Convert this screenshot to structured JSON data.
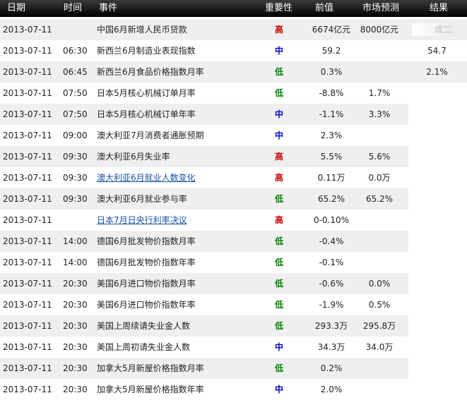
{
  "header": {
    "date": "日期",
    "time": "时间",
    "event": "事件",
    "importance": "重要性",
    "previous": "前值",
    "forecast": "市场预测",
    "result": "结果"
  },
  "colors": {
    "header_background": "#000000",
    "importance_high": "#cc0000",
    "importance_medium": "#0000cc",
    "importance_low": "#008000",
    "link": "#1a52a8",
    "row_stripe": "#efefef"
  },
  "rows": [
    {
      "date": "2013-07-11",
      "time": "",
      "event": "中国6月新增人民币贷款",
      "importance": "高",
      "previous": "6674亿元",
      "forecast": "8000亿元",
      "result": "",
      "link": false
    },
    {
      "date": "2013-07-11",
      "time": "06:30",
      "event": "新西兰6月制造业表现指数",
      "importance": "中",
      "previous": "59.2",
      "forecast": "",
      "result": "54.7",
      "link": false
    },
    {
      "date": "2013-07-11",
      "time": "06:45",
      "event": "新西兰6月食品价格指数月率",
      "importance": "低",
      "previous": "0.3%",
      "forecast": "",
      "result": "2.1%",
      "link": false
    },
    {
      "date": "2013-07-11",
      "time": "07:50",
      "event": "日本5月核心机械订单月率",
      "importance": "低",
      "previous": "-8.8%",
      "forecast": "1.7%",
      "result": "",
      "link": false
    },
    {
      "date": "2013-07-11",
      "time": "07:50",
      "event": "日本5月核心机械订单年率",
      "importance": "中",
      "previous": "-1.1%",
      "forecast": "3.3%",
      "result": "",
      "link": false
    },
    {
      "date": "2013-07-11",
      "time": "09:00",
      "event": "澳大利亚7月消费者通胀预期",
      "importance": "中",
      "previous": "2.3%",
      "forecast": "",
      "result": "",
      "link": false
    },
    {
      "date": "2013-07-11",
      "time": "09:30",
      "event": "澳大利亚6月失业率",
      "importance": "高",
      "previous": "5.5%",
      "forecast": "5.6%",
      "result": "",
      "link": false
    },
    {
      "date": "2013-07-11",
      "time": "09:30",
      "event": "澳大利亚6月就业人数变化",
      "importance": "高",
      "previous": "0.11万",
      "forecast": "0.0万",
      "result": "",
      "link": true
    },
    {
      "date": "2013-07-11",
      "time": "09:30",
      "event": "澳大利亚6月就业参与率",
      "importance": "低",
      "previous": "65.2%",
      "forecast": "65.2%",
      "result": "",
      "link": false
    },
    {
      "date": "2013-07-11",
      "time": "",
      "event": "日本7月日央行利率决议",
      "importance": "高",
      "previous": "0-0.10%",
      "forecast": "",
      "result": "",
      "link": true
    },
    {
      "date": "2013-07-11",
      "time": "14:00",
      "event": "德国6月批发物价指数月率",
      "importance": "低",
      "previous": "-0.4%",
      "forecast": "",
      "result": "",
      "link": false
    },
    {
      "date": "2013-07-11",
      "time": "14:00",
      "event": "德国6月批发物价指数年率",
      "importance": "低",
      "previous": "-0.1%",
      "forecast": "",
      "result": "",
      "link": false
    },
    {
      "date": "2013-07-11",
      "time": "20:30",
      "event": "美国6月进口物价指数月率",
      "importance": "低",
      "previous": "-0.6%",
      "forecast": "0.0%",
      "result": "",
      "link": false
    },
    {
      "date": "2013-07-11",
      "time": "20:30",
      "event": "美国6月进口物价指数年率",
      "importance": "低",
      "previous": "-1.9%",
      "forecast": "0.5%",
      "result": "",
      "link": false
    },
    {
      "date": "2013-07-11",
      "time": "20:30",
      "event": "美国上周续请失业金人数",
      "importance": "低",
      "previous": "293.3万",
      "forecast": "295.8万",
      "result": "",
      "link": false
    },
    {
      "date": "2013-07-11",
      "time": "20:30",
      "event": "美国上周初请失业金人数",
      "importance": "中",
      "previous": "34.3万",
      "forecast": "34.0万",
      "result": "",
      "link": false
    },
    {
      "date": "2013-07-11",
      "time": "20:30",
      "event": "加拿大5月新屋价格指数月率",
      "importance": "低",
      "previous": "0.2%",
      "forecast": "",
      "result": "",
      "link": false
    },
    {
      "date": "2013-07-11",
      "time": "20:30",
      "event": "加拿大5月新屋价格指数年率",
      "importance": "中",
      "previous": "2.0%",
      "forecast": "",
      "result": "",
      "link": false
    }
  ]
}
